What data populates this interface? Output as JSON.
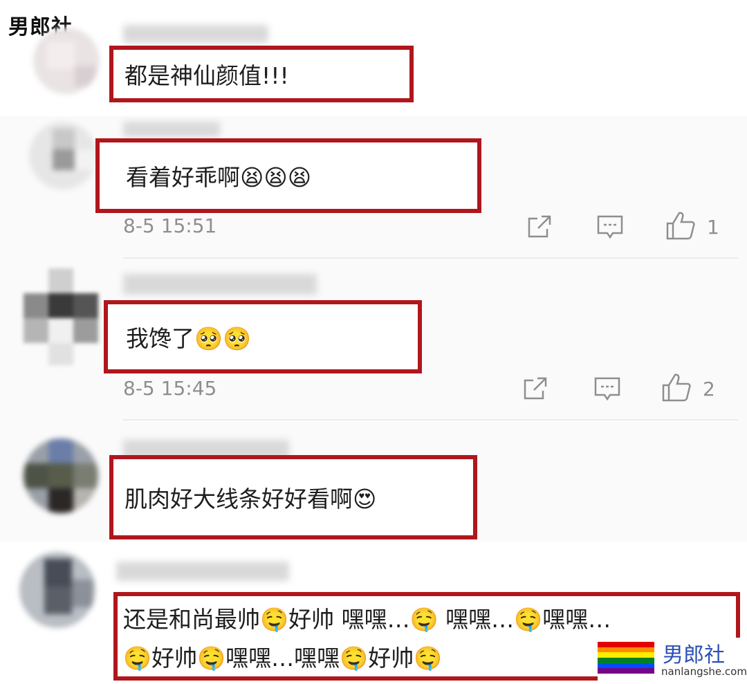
{
  "watermark_top": "男郎社",
  "comments": [
    {
      "text": "都是神仙颜值!!!"
    },
    {
      "text": "看着好乖啊😫😫😫",
      "time": "8-5 15:51",
      "likes": "1"
    },
    {
      "text": "我馋了🥺🥺",
      "time": "8-5 15:45",
      "likes": "2"
    },
    {
      "text": "肌肉好大线条好好看啊😍"
    },
    {
      "line1": "还是和尚最帅🤤好帅 嘿嘿…🤤 嘿嘿…🤤嘿嘿…",
      "line2": "🤤好帅🤤嘿嘿…嘿嘿🤤好帅🤤"
    }
  ],
  "watermark_bottom": {
    "name": "男郎社",
    "url": "nanlangshe.com"
  },
  "colors": {
    "highlight_box": "#b0161c",
    "meta_text": "#8e8e8e"
  },
  "icons": [
    "share-icon",
    "reply-icon",
    "thumbs-up-icon"
  ]
}
